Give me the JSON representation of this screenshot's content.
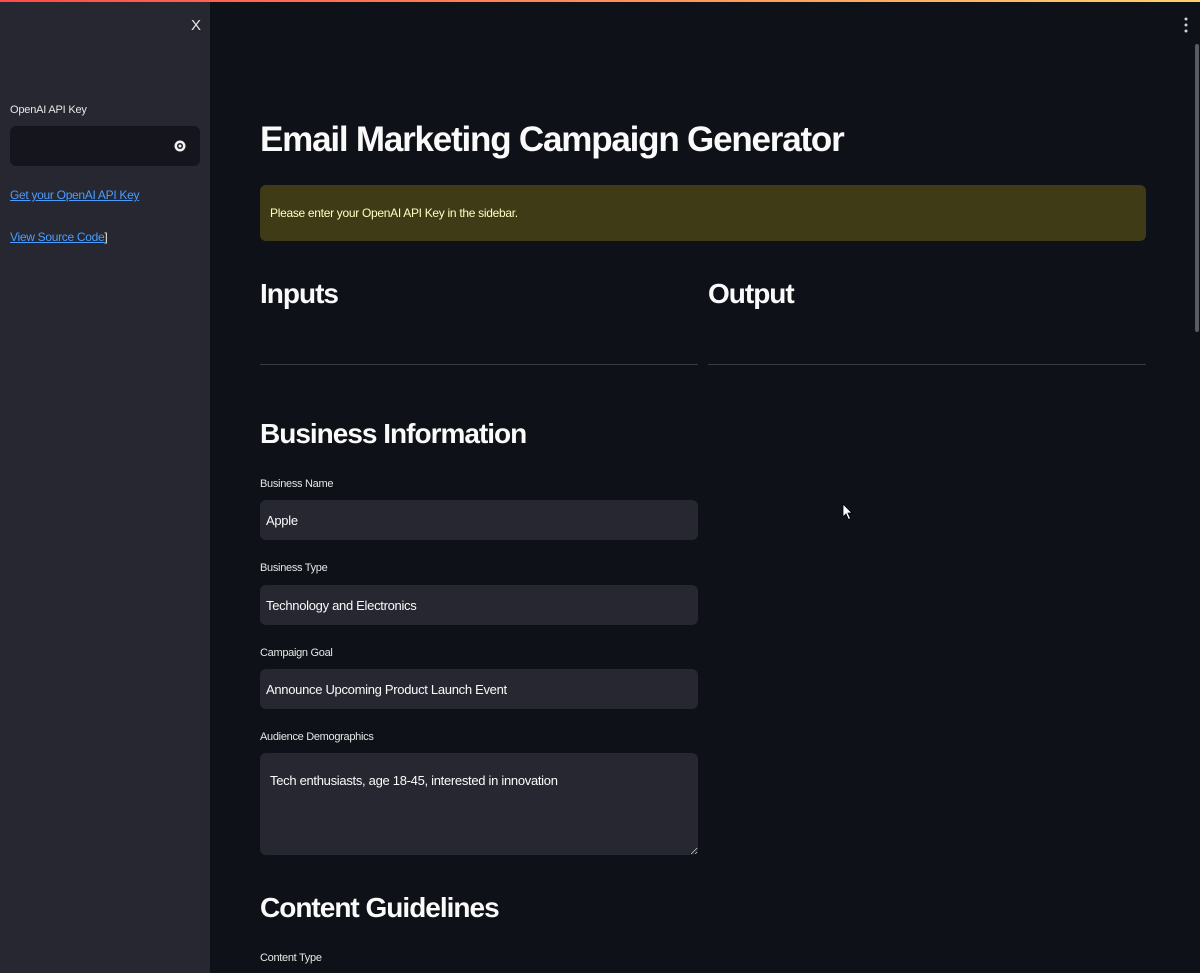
{
  "sidebar": {
    "close_label": "X",
    "api_key_label": "OpenAI API Key",
    "api_key_value": "",
    "get_key_link": "Get your OpenAI API Key",
    "source_link": "View Source Code",
    "source_link_suffix": "]"
  },
  "main": {
    "title": "Email Marketing Campaign Generator",
    "alert": "Please enter your OpenAI API Key in the sidebar.",
    "inputs_heading": "Inputs",
    "output_heading": "Output"
  },
  "business": {
    "heading": "Business Information",
    "fields": [
      {
        "label": "Business Name",
        "value": "Apple"
      },
      {
        "label": "Business Type",
        "value": "Technology and Electronics"
      },
      {
        "label": "Campaign Goal",
        "value": "Announce Upcoming Product Launch Event"
      },
      {
        "label": "Audience Demographics",
        "value": "Tech enthusiasts, age 18-45, interested in innovation"
      }
    ]
  },
  "content": {
    "heading": "Content Guidelines",
    "type_label": "Content Type"
  },
  "colors": {
    "background": "#0e1117",
    "sidebar": "#262730",
    "input": "#262730",
    "alert_bg": "#3e3b16",
    "alert_text": "#ffffc2",
    "link": "#4a9dff",
    "accent_gradient_start": "#ff4b4b",
    "accent_gradient_end": "#ffd16a"
  },
  "icons": [
    "close-icon",
    "eye-icon",
    "kebab-menu-icon",
    "mouse-cursor-icon"
  ]
}
